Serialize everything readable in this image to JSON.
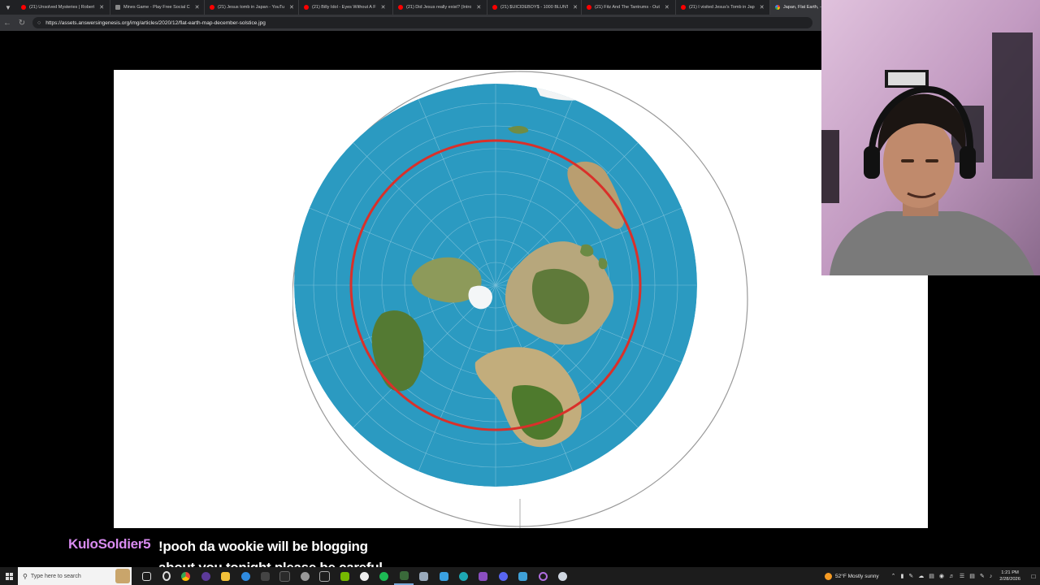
{
  "tabs": [
    {
      "title": "(21) Unsolved Mysteries | Robert",
      "favicon": "youtube-icon"
    },
    {
      "title": "Mines Game - Play Free Social C",
      "favicon": "site-icon"
    },
    {
      "title": "(21) Jesus tomb in Japan - YouTu",
      "favicon": "youtube-icon"
    },
    {
      "title": "(21) Billy Idol - Eyes Without A F",
      "favicon": "youtube-icon"
    },
    {
      "title": "(21) Did Jesus really exist? (Intro",
      "favicon": "youtube-icon"
    },
    {
      "title": "(21) $UICIDEBOY$ - 1000 BLUNT",
      "favicon": "youtube-icon"
    },
    {
      "title": "(21) Fitz And The Tantrums - Out",
      "favicon": "youtube-icon"
    },
    {
      "title": "(21) I visited Jesus's Tomb in Jap",
      "favicon": "youtube-icon"
    },
    {
      "title": "Japan, Flat Earth, - G",
      "favicon": "google-icon"
    }
  ],
  "address_bar": {
    "url": "https://assets.answersingenesis.org/img/articles/2020/12/flat-earth-map-december-solstice.jpg"
  },
  "chat": {
    "username": "KuloSoldier5",
    "message": "!pooh da wookie will be blogging about you tonight please be careful"
  },
  "taskbar": {
    "search_placeholder": "Type here to search",
    "weather": "52°F  Mostly sunny",
    "time": "1:21 PM",
    "date": "2/28/2026"
  },
  "colors": {
    "ocean": "#2b9ac1",
    "tropic_circle": "#d9302a",
    "chat_username": "#d98bf0",
    "taskbar_bg": "#1c1c1c"
  }
}
